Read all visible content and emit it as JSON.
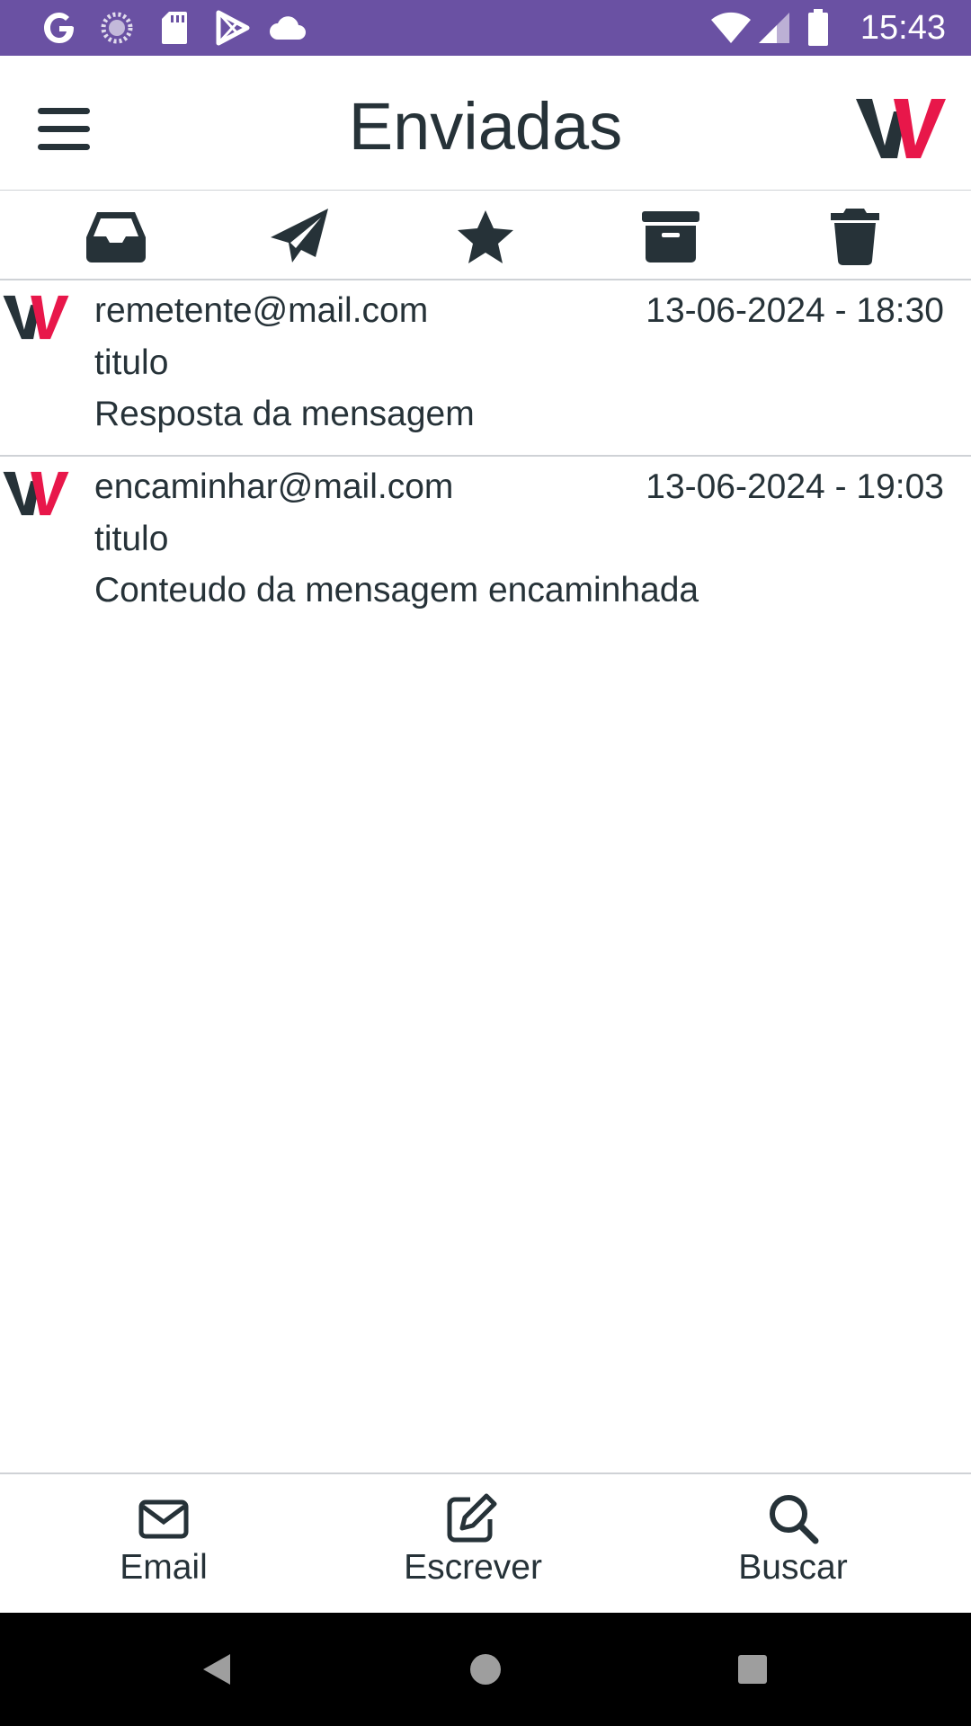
{
  "status_bar": {
    "time": "15:43",
    "background": "#6a51a3",
    "left_icons": [
      "google-icon",
      "sync-icon",
      "sd-card-icon",
      "play-store-icon",
      "cloud-icon"
    ],
    "right_icons": [
      "wifi-icon",
      "signal-icon",
      "battery-icon"
    ]
  },
  "header": {
    "title": "Enviadas",
    "menu_icon": "hamburger-menu-icon",
    "logo": "w-logo"
  },
  "folders": [
    {
      "name": "inbox",
      "icon": "inbox-icon"
    },
    {
      "name": "sent",
      "icon": "paper-plane-icon"
    },
    {
      "name": "starred",
      "icon": "star-icon"
    },
    {
      "name": "archive",
      "icon": "archive-icon"
    },
    {
      "name": "trash",
      "icon": "trash-icon"
    }
  ],
  "messages": [
    {
      "from": "remetente@mail.com",
      "date": "13-06-2024 - 18:30",
      "subject": "titulo",
      "preview": "Resposta da mensagem"
    },
    {
      "from": "encaminhar@mail.com",
      "date": "13-06-2024 - 19:03",
      "subject": "titulo",
      "preview": "Conteudo da mensagem encaminhada"
    }
  ],
  "tabs": [
    {
      "label": "Email",
      "icon": "envelope-icon"
    },
    {
      "label": "Escrever",
      "icon": "compose-icon"
    },
    {
      "label": "Buscar",
      "icon": "search-icon"
    }
  ],
  "colors": {
    "accent": "#6a51a3",
    "text": "#263238",
    "logo_dark": "#263238",
    "logo_red": "#e8174a",
    "divider": "#cfd2d6"
  }
}
